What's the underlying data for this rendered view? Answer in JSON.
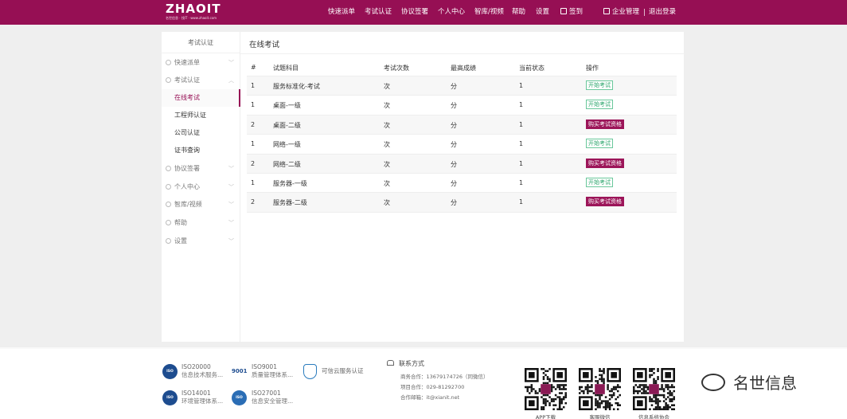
{
  "header": {
    "logo": "ZHAOIT",
    "logo_sub": "名世信息 · 找IT · www.zhaoit.com",
    "nav": [
      {
        "label": "快速派单"
      },
      {
        "label": "考试认证"
      },
      {
        "label": "协议签署"
      },
      {
        "label": "个人中心"
      },
      {
        "label": "智库/视频"
      },
      {
        "label": "帮助"
      },
      {
        "label": "设置"
      },
      {
        "label": "签到"
      },
      {
        "label": "企业管理"
      },
      {
        "label": "退出登录"
      }
    ],
    "accent": "#960f54"
  },
  "sidebar": {
    "title": "考试认证",
    "items": [
      {
        "label": "快速派单"
      },
      {
        "label": "考试认证"
      },
      {
        "label": "协议签署"
      },
      {
        "label": "个人中心"
      },
      {
        "label": "智库/视频"
      },
      {
        "label": "帮助"
      },
      {
        "label": "设置"
      }
    ],
    "subitems": [
      {
        "label": "在线考试"
      },
      {
        "label": "工程师认证"
      },
      {
        "label": "公司认证"
      },
      {
        "label": "证书查询"
      }
    ]
  },
  "main": {
    "title": "在线考试",
    "columns": [
      "#",
      "试题科目",
      "考试次数",
      "最高成绩",
      "当前状态",
      "操作"
    ],
    "rows": [
      {
        "num": "1",
        "subject": "服务标准化-考试",
        "count": "次",
        "score": "分",
        "status": "1",
        "action": "开始考试",
        "kind": "start"
      },
      {
        "num": "1",
        "subject": "桌面-一级",
        "count": "次",
        "score": "分",
        "status": "1",
        "action": "开始考试",
        "kind": "start"
      },
      {
        "num": "2",
        "subject": "桌面-二级",
        "count": "次",
        "score": "分",
        "status": "1",
        "action": "购买考试资格",
        "kind": "buy"
      },
      {
        "num": "1",
        "subject": "网络-一级",
        "count": "次",
        "score": "分",
        "status": "1",
        "action": "开始考试",
        "kind": "start"
      },
      {
        "num": "2",
        "subject": "网络-二级",
        "count": "次",
        "score": "分",
        "status": "1",
        "action": "购买考试资格",
        "kind": "buy"
      },
      {
        "num": "1",
        "subject": "服务器-一级",
        "count": "次",
        "score": "分",
        "status": "1",
        "action": "开始考试",
        "kind": "start"
      },
      {
        "num": "2",
        "subject": "服务器-二级",
        "count": "次",
        "score": "分",
        "status": "1",
        "action": "购买考试资格",
        "kind": "buy"
      }
    ]
  },
  "footer": {
    "certs": [
      {
        "icon": "ISO",
        "title": "ISO20000",
        "desc": "信息技术服务..."
      },
      {
        "icon": "9001",
        "title": "ISO9001",
        "desc": "质量管理体系..."
      },
      {
        "icon": "",
        "title": "可信云服务认证",
        "desc": ""
      },
      {
        "icon": "ISO",
        "title": "ISO14001",
        "desc": "环境管理体系..."
      },
      {
        "icon": "ISO",
        "title": "ISO27001",
        "desc": "信息安全管理..."
      }
    ],
    "contact": {
      "title": "联系方式",
      "lines": [
        "商务合作：13679174726（同微信）",
        "项目合作：029-81292700",
        "合作邮箱：it@xianit.net"
      ]
    },
    "qrcodes": [
      {
        "label": "APP下载"
      },
      {
        "label": "客服微信"
      },
      {
        "label": "信息系统协会"
      }
    ]
  },
  "watermark": "名世信息"
}
